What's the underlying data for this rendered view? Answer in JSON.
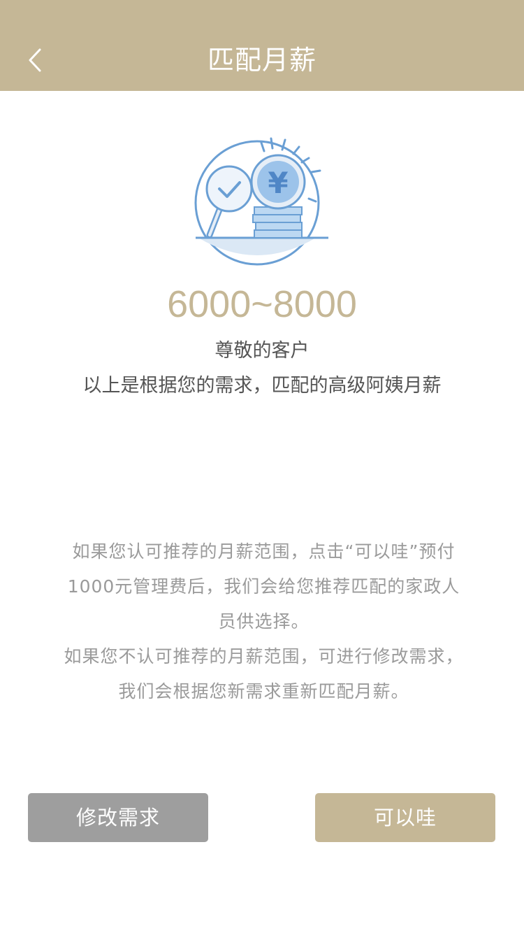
{
  "header": {
    "title": "匹配月薪",
    "back_icon": "chevron-left-icon",
    "background_color": "#c5b796"
  },
  "illustration": {
    "icon": "coin-magnifier-illustration",
    "symbol": "¥",
    "accent_color": "#6a9fd4"
  },
  "result": {
    "salary_range": "6000~8000",
    "greeting": "尊敬的客户",
    "description": "以上是根据您的需求，匹配的高级阿姨月薪"
  },
  "notice": {
    "paragraph_1": "如果您认可推荐的月薪范围，点击“可以哇”预付1000元管理费后，我们会给您推荐匹配的家政人员供选择。",
    "paragraph_2": "如果您不认可推荐的月薪范围，可进行修改需求，我们会根据您新需求重新匹配月薪。"
  },
  "actions": {
    "modify_label": "修改需求",
    "accept_label": "可以哇",
    "modify_color": "#9e9e9e",
    "accept_color": "#c5b796"
  }
}
